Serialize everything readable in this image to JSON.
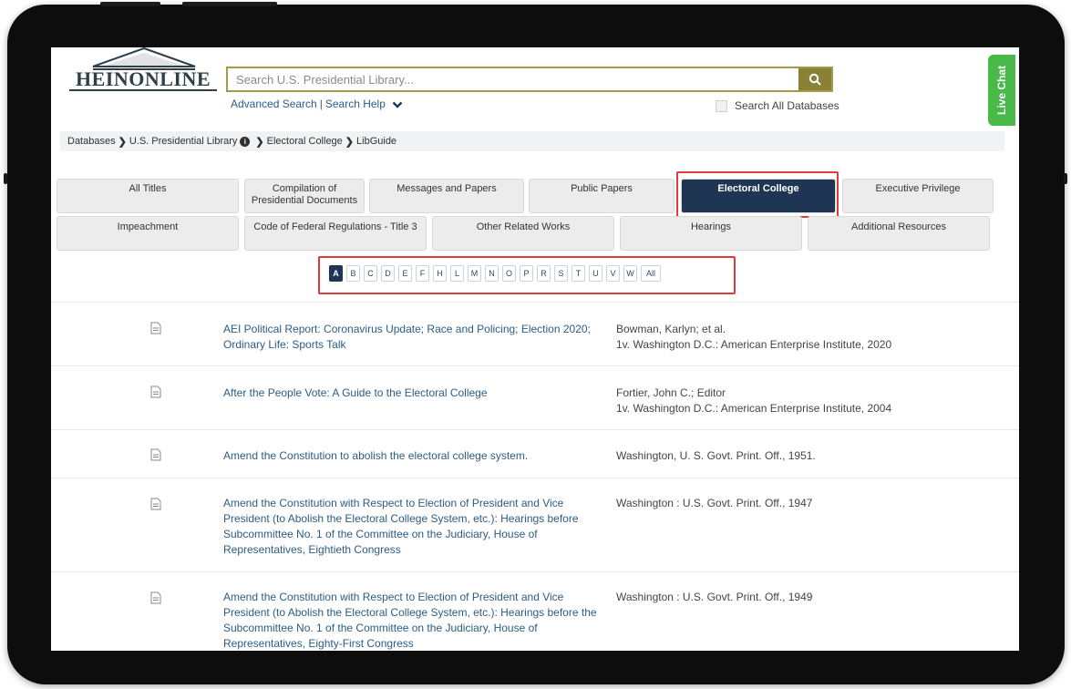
{
  "header": {
    "logo_text": "HEINONLINE",
    "search_placeholder": "Search U.S. Presidential Library...",
    "advanced_search": "Advanced Search",
    "link_separator": "|",
    "search_help": "Search Help",
    "search_all": "Search All Databases",
    "live_chat": "Live Chat"
  },
  "breadcrumb": [
    "Databases",
    "U.S. Presidential Library",
    "Electoral College",
    "LibGuide"
  ],
  "tabs_row1": [
    "All Titles",
    "Compilation of Presidential Documents",
    "Messages and Papers",
    "Public Papers",
    "Electoral College",
    "Executive Privilege"
  ],
  "tabs_row2": [
    "Impeachment",
    "Code of Federal Regulations - Title 3",
    "Other Related Works",
    "Hearings",
    "Additional Resources"
  ],
  "active_tab": "Electoral College",
  "alphabet": [
    "A",
    "B",
    "C",
    "D",
    "E",
    "F",
    "H",
    "L",
    "M",
    "N",
    "O",
    "P",
    "R",
    "S",
    "T",
    "U",
    "V",
    "W",
    "All"
  ],
  "active_letter": "A",
  "results": [
    {
      "title": "AEI Political Report: Coronavirus Update; Race and Policing; Election 2020; Ordinary Life: Sports Talk",
      "author": "Bowman, Karlyn; et al.",
      "publication": "1v. Washington D.C.: American Enterprise Institute, 2020"
    },
    {
      "title": "After the People Vote: A Guide to the Electoral College",
      "author": "Fortier, John C.; Editor",
      "publication": "1v. Washington D.C.: American Enterprise Institute, 2004"
    },
    {
      "title": "Amend the Constitution to abolish the electoral college system.",
      "author": "",
      "publication": "Washington, U. S. Govt. Print. Off., 1951."
    },
    {
      "title": "Amend the Constitution with Respect to Election of President and Vice President (to Abolish the Electoral College System, etc.): Hearings before Subcommittee No. 1 of the Committee on the Judiciary, House of Representatives, Eightieth Congress",
      "author": "",
      "publication": "Washington : U.S. Govt. Print. Off., 1947"
    },
    {
      "title": "Amend the Constitution with Respect to Election of President and Vice President (to Abolish the Electoral College System, etc.): Hearings before the Subcommittee No. 1 of the Committee on the Judiciary, House of Representatives, Eighty-First Congress",
      "author": "",
      "publication": "Washington : U.S. Govt. Print. Off., 1949"
    }
  ],
  "colors": {
    "accent_olive": "#8a8136",
    "active_tab": "#1e3554",
    "highlight": "#e03a3a",
    "link": "#2b5d84",
    "live_chat": "#4bb84a"
  }
}
